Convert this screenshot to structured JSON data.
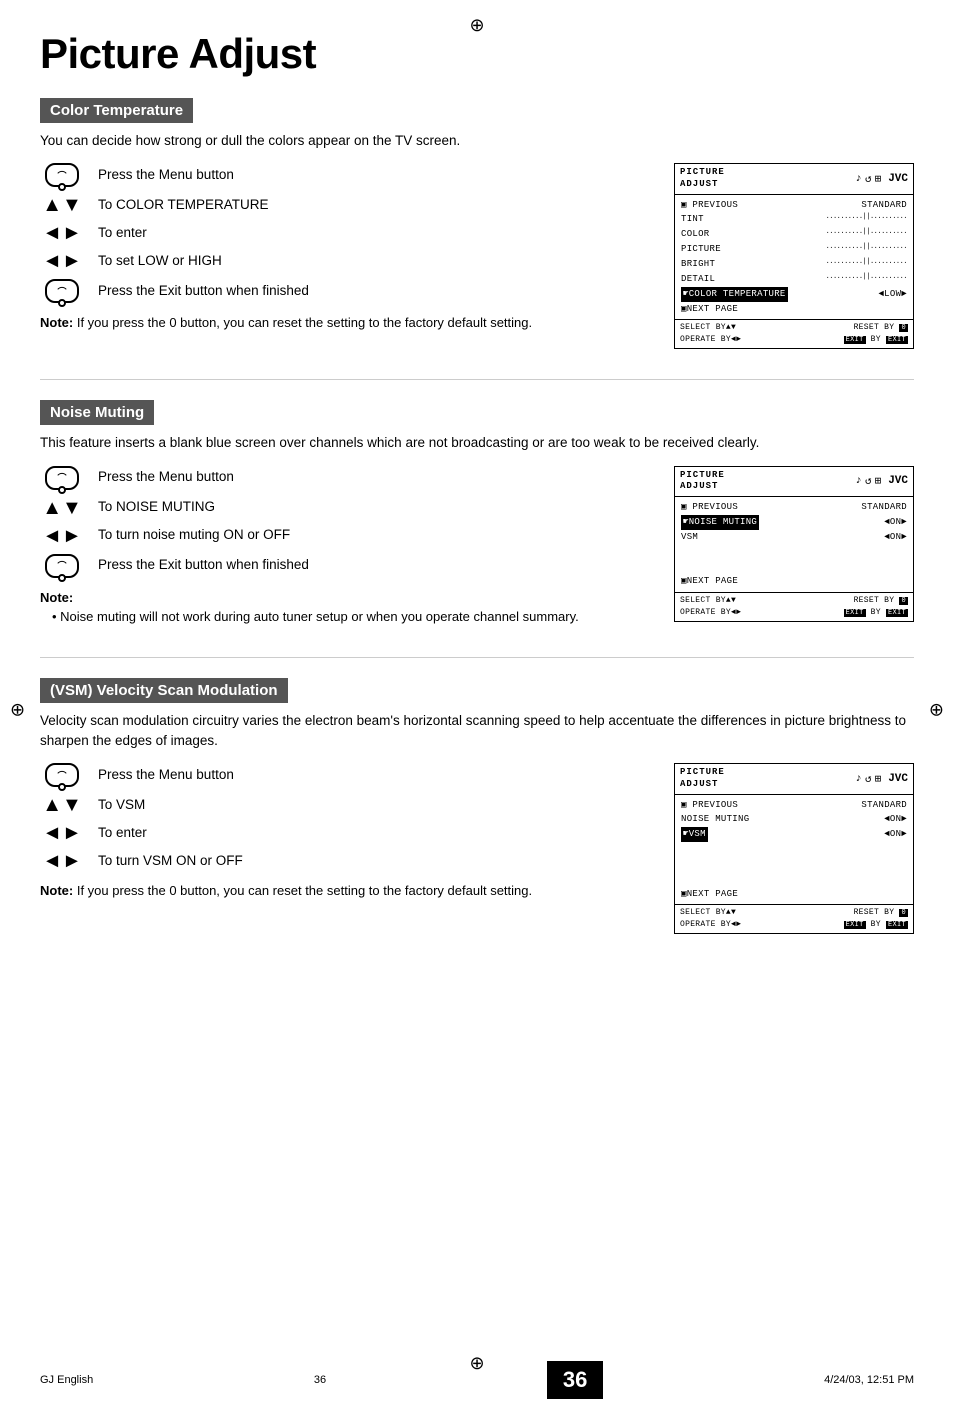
{
  "page": {
    "title": "Picture Adjust",
    "footer_left": "GJ English",
    "footer_center": "36",
    "footer_right": "4/24/03, 12:51 PM",
    "page_number": "36"
  },
  "sections": [
    {
      "id": "color-temperature",
      "header": "Color Temperature",
      "description": "You can decide how strong or dull the colors appear on the TV screen.",
      "instructions": [
        {
          "icon": "menu",
          "text": "Press the Menu button"
        },
        {
          "icon": "updown",
          "text": "To COLOR TEMPERATURE"
        },
        {
          "icon": "leftright",
          "text": "To enter"
        },
        {
          "icon": "leftright",
          "text": "To set LOW or HIGH"
        },
        {
          "icon": "menu",
          "text": "Press the Exit button when finished"
        }
      ],
      "note": "Note: If you press the 0 button, you can reset the setting to the factory default setting.",
      "osd": {
        "header_left": "PICTURE\nADJUST",
        "icons": [
          "♪",
          "↺",
          "⊞"
        ],
        "brand": "JVC",
        "rows": [
          {
            "type": "label-value",
            "label": "▣ PREVIOUS",
            "value": "STANDARD"
          },
          {
            "type": "label-dots",
            "label": "TINT",
            "dots": "..........||.........."
          },
          {
            "type": "label-dots",
            "label": "COLOR",
            "dots": "..........||.........."
          },
          {
            "type": "label-dots",
            "label": "PICTURE",
            "dots": "..........||.........."
          },
          {
            "type": "label-dots",
            "label": "BRIGHT",
            "dots": "..........||.........."
          },
          {
            "type": "label-dots",
            "label": "DETAIL",
            "dots": "..........||.........."
          },
          {
            "type": "highlighted",
            "label": "☛COLOR TEMPERATURE",
            "value": "◄LOW►"
          },
          {
            "type": "label-only",
            "label": "▣NEXT PAGE"
          }
        ],
        "footer": [
          {
            "left": "SELECT  BY▲▼",
            "right": "RESET BY 0"
          },
          {
            "left": "OPERATE BY◄►",
            "right": "EXIT BY EXIT"
          }
        ]
      }
    },
    {
      "id": "noise-muting",
      "header": "Noise Muting",
      "description": "This feature inserts a blank blue screen over channels which are not broadcasting or are too weak to be received clearly.",
      "instructions": [
        {
          "icon": "menu",
          "text": "Press the Menu button"
        },
        {
          "icon": "updown",
          "text": "To NOISE MUTING"
        },
        {
          "icon": "leftright",
          "text": "To turn noise muting ON or OFF"
        },
        {
          "icon": "menu",
          "text": "Press the Exit button when finished"
        }
      ],
      "note": "Note:",
      "note_bullets": [
        "Noise muting will not work during auto tuner setup or when you operate channel summary."
      ],
      "osd": {
        "header_left": "PICTURE\nADJUST",
        "icons": [
          "♪",
          "↺",
          "⊞"
        ],
        "brand": "JVC",
        "rows": [
          {
            "type": "label-value",
            "label": "▣ PREVIOUS",
            "value": "STANDARD"
          },
          {
            "type": "highlighted-value",
            "label": "☛NOISE MUTING",
            "value": "◄ON►"
          },
          {
            "type": "label-value",
            "label": "VSM",
            "value": "◄ON►"
          },
          {
            "type": "empty"
          },
          {
            "type": "empty"
          },
          {
            "type": "label-only",
            "label": "▣NEXT PAGE"
          }
        ],
        "footer": [
          {
            "left": "SELECT  BY▲▼",
            "right": "RESET BY 0"
          },
          {
            "left": "OPERATE BY◄►",
            "right": "EXIT BY EXIT"
          }
        ]
      }
    },
    {
      "id": "vsm",
      "header": "(VSM) Velocity Scan Modulation",
      "description": "Velocity scan modulation circuitry varies the electron beam's horizontal scanning speed to help accentuate the differences in picture brightness to sharpen the edges of images.",
      "instructions": [
        {
          "icon": "menu",
          "text": "Press the Menu button"
        },
        {
          "icon": "updown",
          "text": "To VSM"
        },
        {
          "icon": "leftright",
          "text": "To enter"
        },
        {
          "icon": "leftright",
          "text": "To turn VSM ON or OFF"
        }
      ],
      "note": "Note: If you press the 0 button, you can reset the setting to the factory default setting.",
      "osd": {
        "header_left": "PICTURE\nADJUST",
        "icons": [
          "♪",
          "↺",
          "⊞"
        ],
        "brand": "JVC",
        "rows": [
          {
            "type": "label-value",
            "label": "▣ PREVIOUS",
            "value": "STANDARD"
          },
          {
            "type": "label-value",
            "label": "NOISE MUTING",
            "value": "◄ON►"
          },
          {
            "type": "highlighted-value",
            "label": "☛VSM",
            "value": "◄ON►"
          },
          {
            "type": "empty"
          },
          {
            "type": "empty"
          },
          {
            "type": "empty"
          },
          {
            "type": "label-only",
            "label": "▣NEXT PAGE"
          }
        ],
        "footer": [
          {
            "left": "SELECT  BY▲▼",
            "right": "RESET BY 0"
          },
          {
            "left": "OPERATE BY◄►",
            "right": "EXIT BY EXIT"
          }
        ]
      }
    }
  ]
}
